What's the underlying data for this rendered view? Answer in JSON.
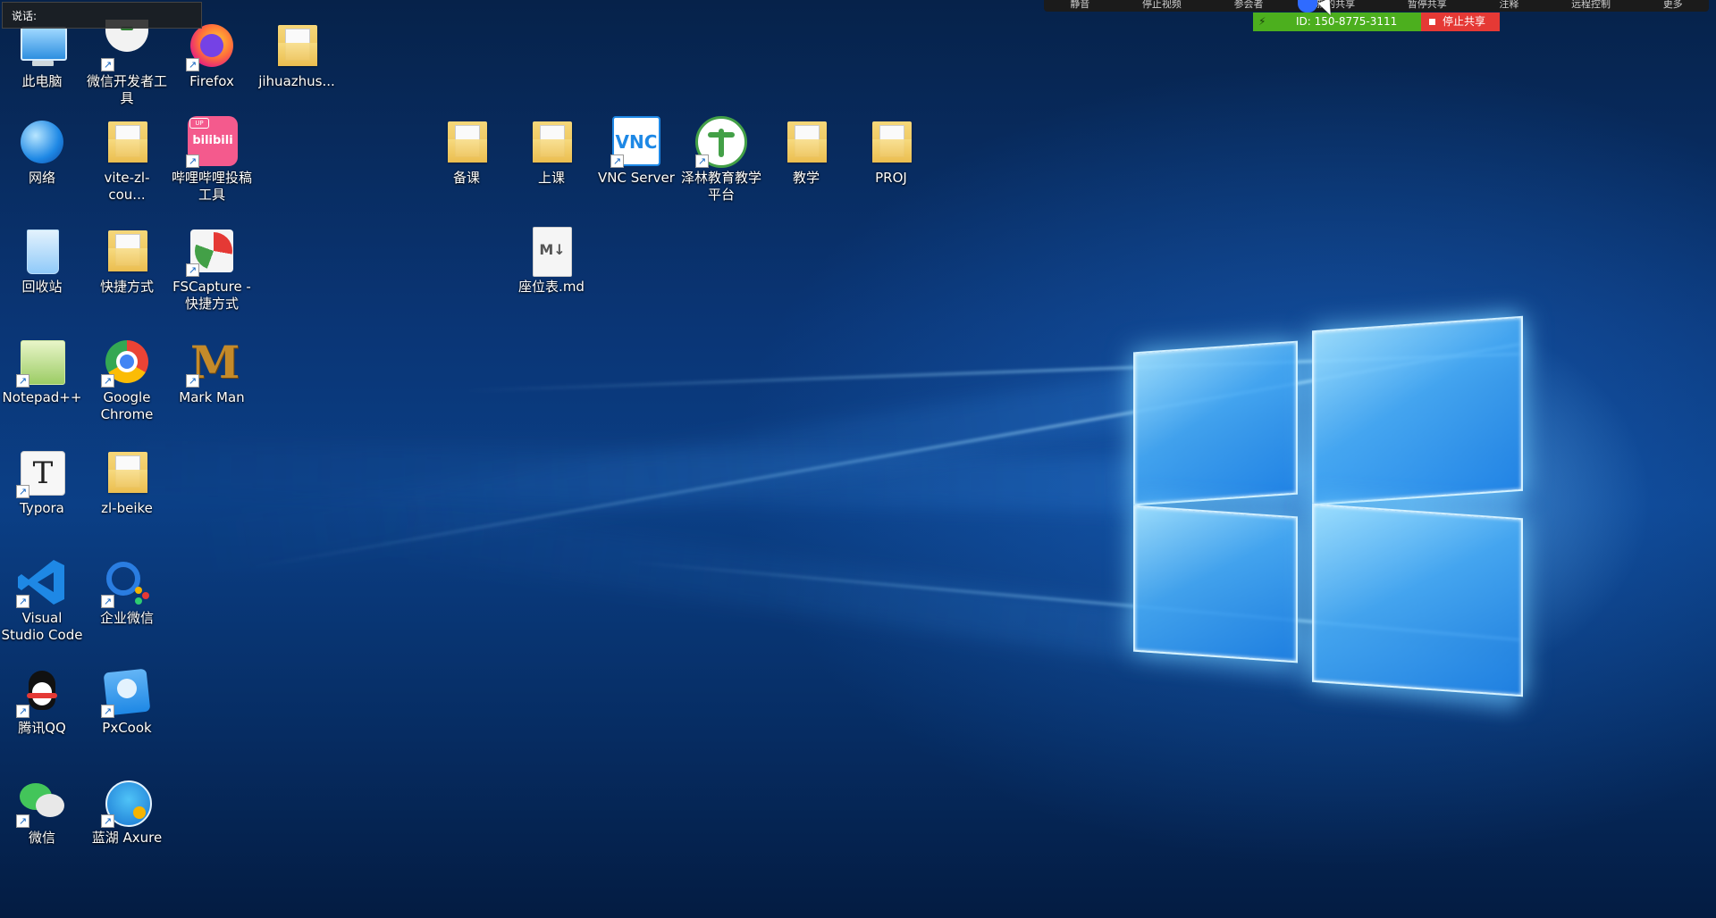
{
  "chat": {
    "label": "说话:"
  },
  "meeting_bar": {
    "items": [
      "静音",
      "停止视频",
      "参会者",
      "新的共享",
      "暂停共享",
      "注释",
      "远程控制",
      "更多"
    ],
    "share_id": "ID: 150-8775-3111",
    "stop_share": "停止共享",
    "share_color": "#4caf1e",
    "stop_color": "#e53935"
  },
  "icons": [
    {
      "label": "此电脑",
      "icon": "computer-icon"
    },
    {
      "label": "微信开发者工具",
      "icon": "wechat-devtools-icon"
    },
    {
      "label": "Firefox",
      "icon": "firefox-icon"
    },
    {
      "label": "jihuazhus...",
      "icon": "folder-icon"
    },
    {
      "label": "网络",
      "icon": "network-icon"
    },
    {
      "label": "vite-zl-cou...",
      "icon": "folder-icon"
    },
    {
      "label": "哔哩哔哩投稿工具",
      "icon": "bilibili-icon",
      "badge": "UP",
      "logo": "bilibili"
    },
    {
      "label": "回收站",
      "icon": "recycle-bin-icon"
    },
    {
      "label": "快捷方式",
      "icon": "folder-icon"
    },
    {
      "label": "FSCapture - 快捷方式",
      "icon": "fscapture-icon"
    },
    {
      "label": "Notepad++",
      "icon": "notepadpp-icon"
    },
    {
      "label": "Google Chrome",
      "icon": "chrome-icon"
    },
    {
      "label": "Mark Man",
      "icon": "markman-icon",
      "logo": "M"
    },
    {
      "label": "Typora",
      "icon": "typora-icon",
      "logo": "T"
    },
    {
      "label": "zl-beike",
      "icon": "folder-icon"
    },
    {
      "label": "Visual Studio Code",
      "icon": "vscode-icon"
    },
    {
      "label": "企业微信",
      "icon": "wecom-icon"
    },
    {
      "label": "腾讯QQ",
      "icon": "qq-icon"
    },
    {
      "label": "PxCook",
      "icon": "pxcook-icon"
    },
    {
      "label": "微信",
      "icon": "wechat-icon"
    },
    {
      "label": "蓝湖 Axure",
      "icon": "lanhu-axure-icon"
    },
    {
      "label": "备课",
      "icon": "folder-icon"
    },
    {
      "label": "上课",
      "icon": "folder-icon"
    },
    {
      "label": "VNC Server",
      "icon": "vnc-icon",
      "logo": "VNC"
    },
    {
      "label": "泽林教育教学平台",
      "icon": "zelin-edu-icon"
    },
    {
      "label": "教学",
      "icon": "folder-icon"
    },
    {
      "label": "PROJ",
      "icon": "folder-icon"
    },
    {
      "label": "座位表.md",
      "icon": "markdown-file-icon",
      "logo": "M↓"
    }
  ]
}
